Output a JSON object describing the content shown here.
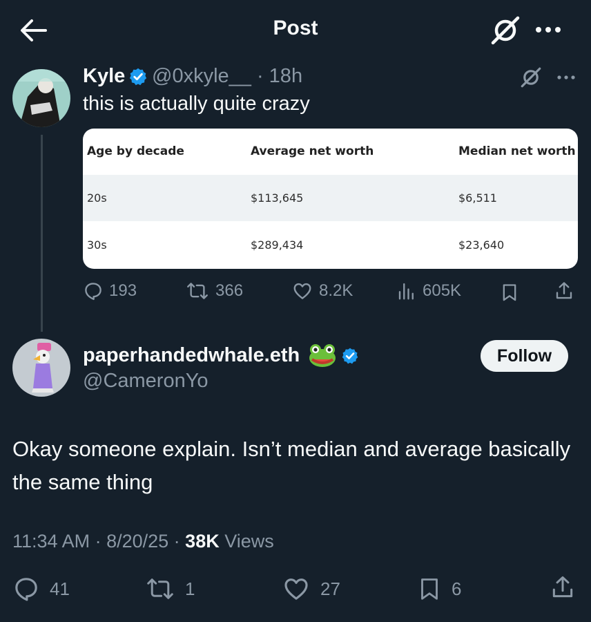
{
  "header": {
    "title": "Post",
    "back_icon": "arrow-left-icon",
    "grok_icon": "grok-icon",
    "more_icon": "more-dots-icon"
  },
  "quoted_post": {
    "author_name": "Kyle",
    "handle": "@0xkyle__",
    "time": "· 18h",
    "text": "this is actually quite crazy",
    "table": {
      "headers": [
        "Age by decade",
        "Average net worth",
        "Median net worth"
      ],
      "rows": [
        [
          "20s",
          "$113,645",
          "$6,511"
        ],
        [
          "30s",
          "$289,434",
          "$23,640"
        ]
      ]
    },
    "stats": {
      "replies": "193",
      "reposts": "366",
      "likes": "8.2K",
      "views": "605K"
    }
  },
  "post": {
    "author_name": "paperhandedwhale.eth",
    "author_emoji": "🐸",
    "handle": "@CameronYo",
    "follow_label": "Follow",
    "text": "Okay someone explain. Isn’t median and average basically the same thing",
    "time": "11:34 AM",
    "date": "8/20/25",
    "views_count": "38K",
    "views_label": "Views",
    "stats": {
      "replies": "41",
      "reposts": "1",
      "likes": "27",
      "bookmarks": "6"
    }
  },
  "colors": {
    "background": "#15202b",
    "text": "#f7f9f9",
    "muted": "#8b98a5",
    "verified": "#1d9bf0"
  }
}
